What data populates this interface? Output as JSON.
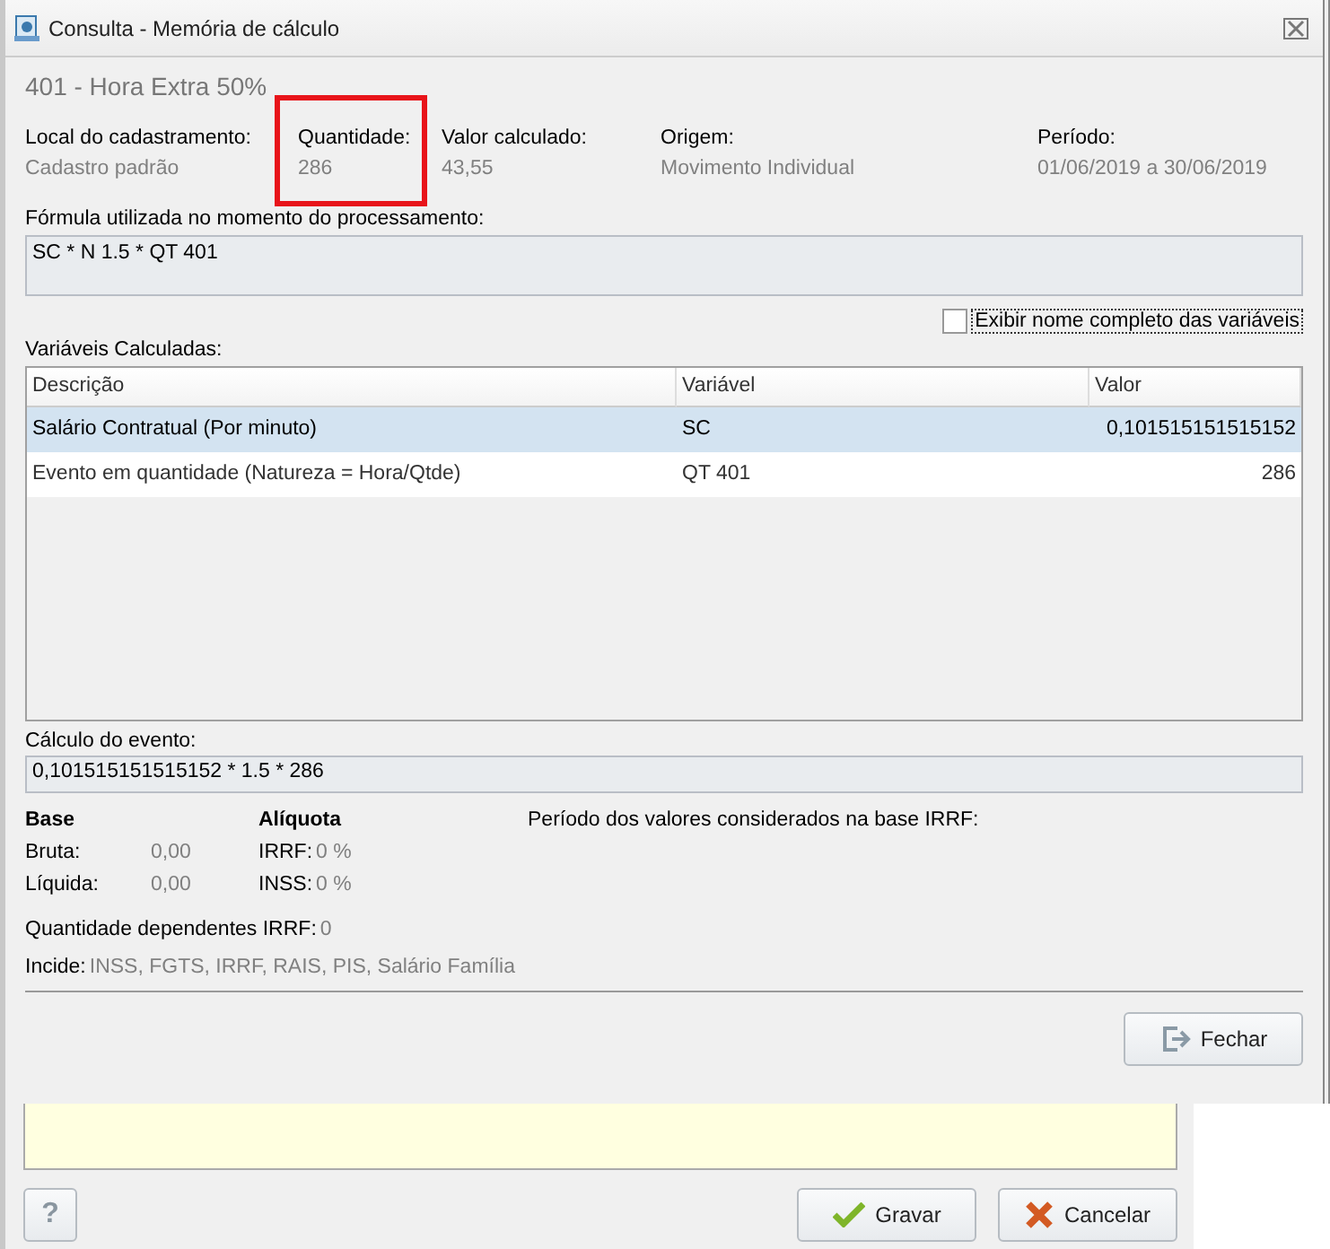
{
  "window": {
    "title": "Consulta - Memória de cálculo"
  },
  "heading": "401 - Hora Extra 50%",
  "fields": [
    {
      "label": "Local do cadastramento:",
      "value": "Cadastro padrão",
      "highlighted": false
    },
    {
      "label": "Quantidade:",
      "value": "286",
      "highlighted": true
    },
    {
      "label": "Valor calculado:",
      "value": "43,55",
      "highlighted": false
    },
    {
      "label": "Origem:",
      "value": "Movimento Individual",
      "highlighted": false
    },
    {
      "label": "Período:",
      "value": "01/06/2019 a 30/06/2019",
      "highlighted": false
    }
  ],
  "formula": {
    "label": "Fórmula utilizada no momento do processamento:",
    "value": "SC * N 1.5 * QT 401"
  },
  "full_names_checkbox": {
    "label": "Exibir nome completo das variáveis",
    "checked": false
  },
  "variables": {
    "label": "Variáveis Calculadas:",
    "columns": [
      "Descrição",
      "Variável",
      "Valor"
    ],
    "rows": [
      {
        "cells": [
          "Salário Contratual (Por minuto)",
          "SC",
          "0,101515151515152"
        ],
        "selected": true
      },
      {
        "cells": [
          "Evento em quantidade (Natureza = Hora/Qtde)",
          "QT 401",
          "286"
        ],
        "selected": false
      }
    ]
  },
  "calculation": {
    "label": "Cálculo do evento:",
    "value": "0,101515151515152 * 1.5 * 286"
  },
  "base": {
    "heading": "Base",
    "rows": [
      {
        "label": "Bruta:",
        "value": "0,00"
      },
      {
        "label": "Líquida:",
        "value": "0,00"
      }
    ]
  },
  "aliquota": {
    "heading": "Alíquota",
    "rows": [
      {
        "label": "IRRF:",
        "value": "0 %"
      },
      {
        "label": "INSS:",
        "value": "0 %"
      }
    ]
  },
  "irrf_period": {
    "label": "Período dos valores considerados na base IRRF:"
  },
  "dependents": {
    "label": "Quantidade dependentes IRRF:",
    "value": "0"
  },
  "incide": {
    "label": "Incide:",
    "value": "INSS, FGTS, IRRF, RAIS, PIS, Salário Família"
  },
  "close_button": {
    "label": "Fechar"
  },
  "background_window": {
    "buttons": [
      {
        "kind": "help",
        "label": "?"
      },
      {
        "kind": "save",
        "label": "Gravar"
      },
      {
        "kind": "cancel",
        "label": "Cancelar"
      }
    ]
  }
}
